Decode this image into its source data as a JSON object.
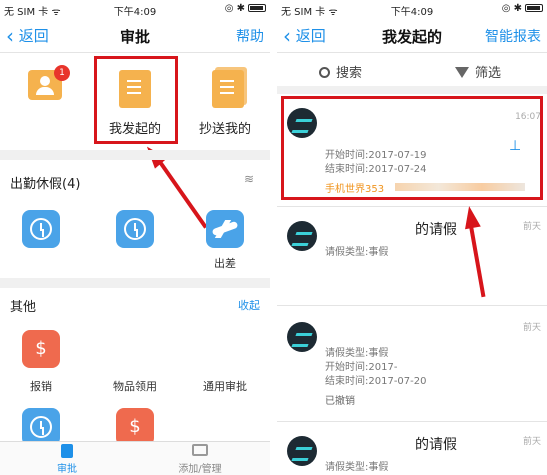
{
  "colors": {
    "accent": "#1e90e8",
    "annotation_red": "#d7151b",
    "doc_orange": "#f5b24e",
    "icon_blue": "#4aa3e8",
    "icon_red": "#ef6a4e",
    "warning_orange": "#f0941e"
  },
  "left": {
    "status": {
      "carrier": "无 SIM 卡 ᯤ",
      "time": "下午4:09",
      "right": "◎ ✱"
    },
    "nav": {
      "back": "返回",
      "title": "审批",
      "right": "帮助"
    },
    "top_items": [
      {
        "label": "",
        "badge": "1"
      },
      {
        "label": "我发起的"
      },
      {
        "label": "抄送我的"
      }
    ],
    "section1": {
      "title": "出勤休假(4)",
      "items": [
        "",
        "",
        "出差"
      ]
    },
    "section2": {
      "title": "其他",
      "action": "收起",
      "items": [
        "报销",
        "物品领用",
        "通用审批"
      ]
    },
    "tabs": [
      {
        "label": "审批"
      },
      {
        "label": "添加/管理"
      }
    ]
  },
  "right": {
    "status": {
      "carrier": "无 SIM 卡 ᯤ",
      "time": "下午4:09",
      "right": "◎ ✱"
    },
    "nav": {
      "back": "返回",
      "title": "我发起的",
      "right": "智能报表"
    },
    "search_label": "搜索",
    "filter_label": "筛选",
    "list": [
      {
        "time": "16:07",
        "lines": [
          "开始时间:2017-07-19",
          "结束时间:2017-07-24"
        ],
        "footer": "手机世界353"
      },
      {
        "time": "前天",
        "title": "的请假",
        "lines": [
          "请假类型:事假"
        ]
      },
      {
        "time": "前天",
        "lines": [
          "请假类型:事假",
          "开始时间:2017-",
          "结束时间:2017-07-20"
        ],
        "status": "已撤销"
      },
      {
        "time": "前天",
        "title": "的请假",
        "lines": [
          "请假类型:事假"
        ]
      }
    ]
  }
}
